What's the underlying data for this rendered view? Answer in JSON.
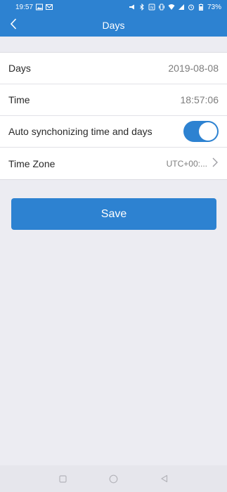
{
  "status_bar": {
    "time": "19:57",
    "battery": "73%",
    "left_icons": [
      "image-icon",
      "mail-icon"
    ],
    "right_icons": [
      "megaphone-icon",
      "bluetooth-icon",
      "nfc-icon",
      "vibrate-icon",
      "wifi-icon",
      "signal-icon",
      "alarm-icon",
      "battery-icon"
    ]
  },
  "header": {
    "title": "Days",
    "back_icon": "chevron-left-icon"
  },
  "settings": {
    "days": {
      "label": "Days",
      "value": "2019-08-08"
    },
    "time": {
      "label": "Time",
      "value": "18:57:06"
    },
    "auto_sync": {
      "label": "Auto synchonizing time and days",
      "enabled": true
    },
    "timezone": {
      "label": "Time Zone",
      "value": "UTC+00:..."
    }
  },
  "actions": {
    "save_label": "Save"
  },
  "nav_bar": {
    "icons": [
      "recents-square-icon",
      "home-circle-icon",
      "back-triangle-icon"
    ]
  },
  "colors": {
    "primary": "#2d82d1",
    "background": "#ececf2",
    "card": "#ffffff"
  }
}
